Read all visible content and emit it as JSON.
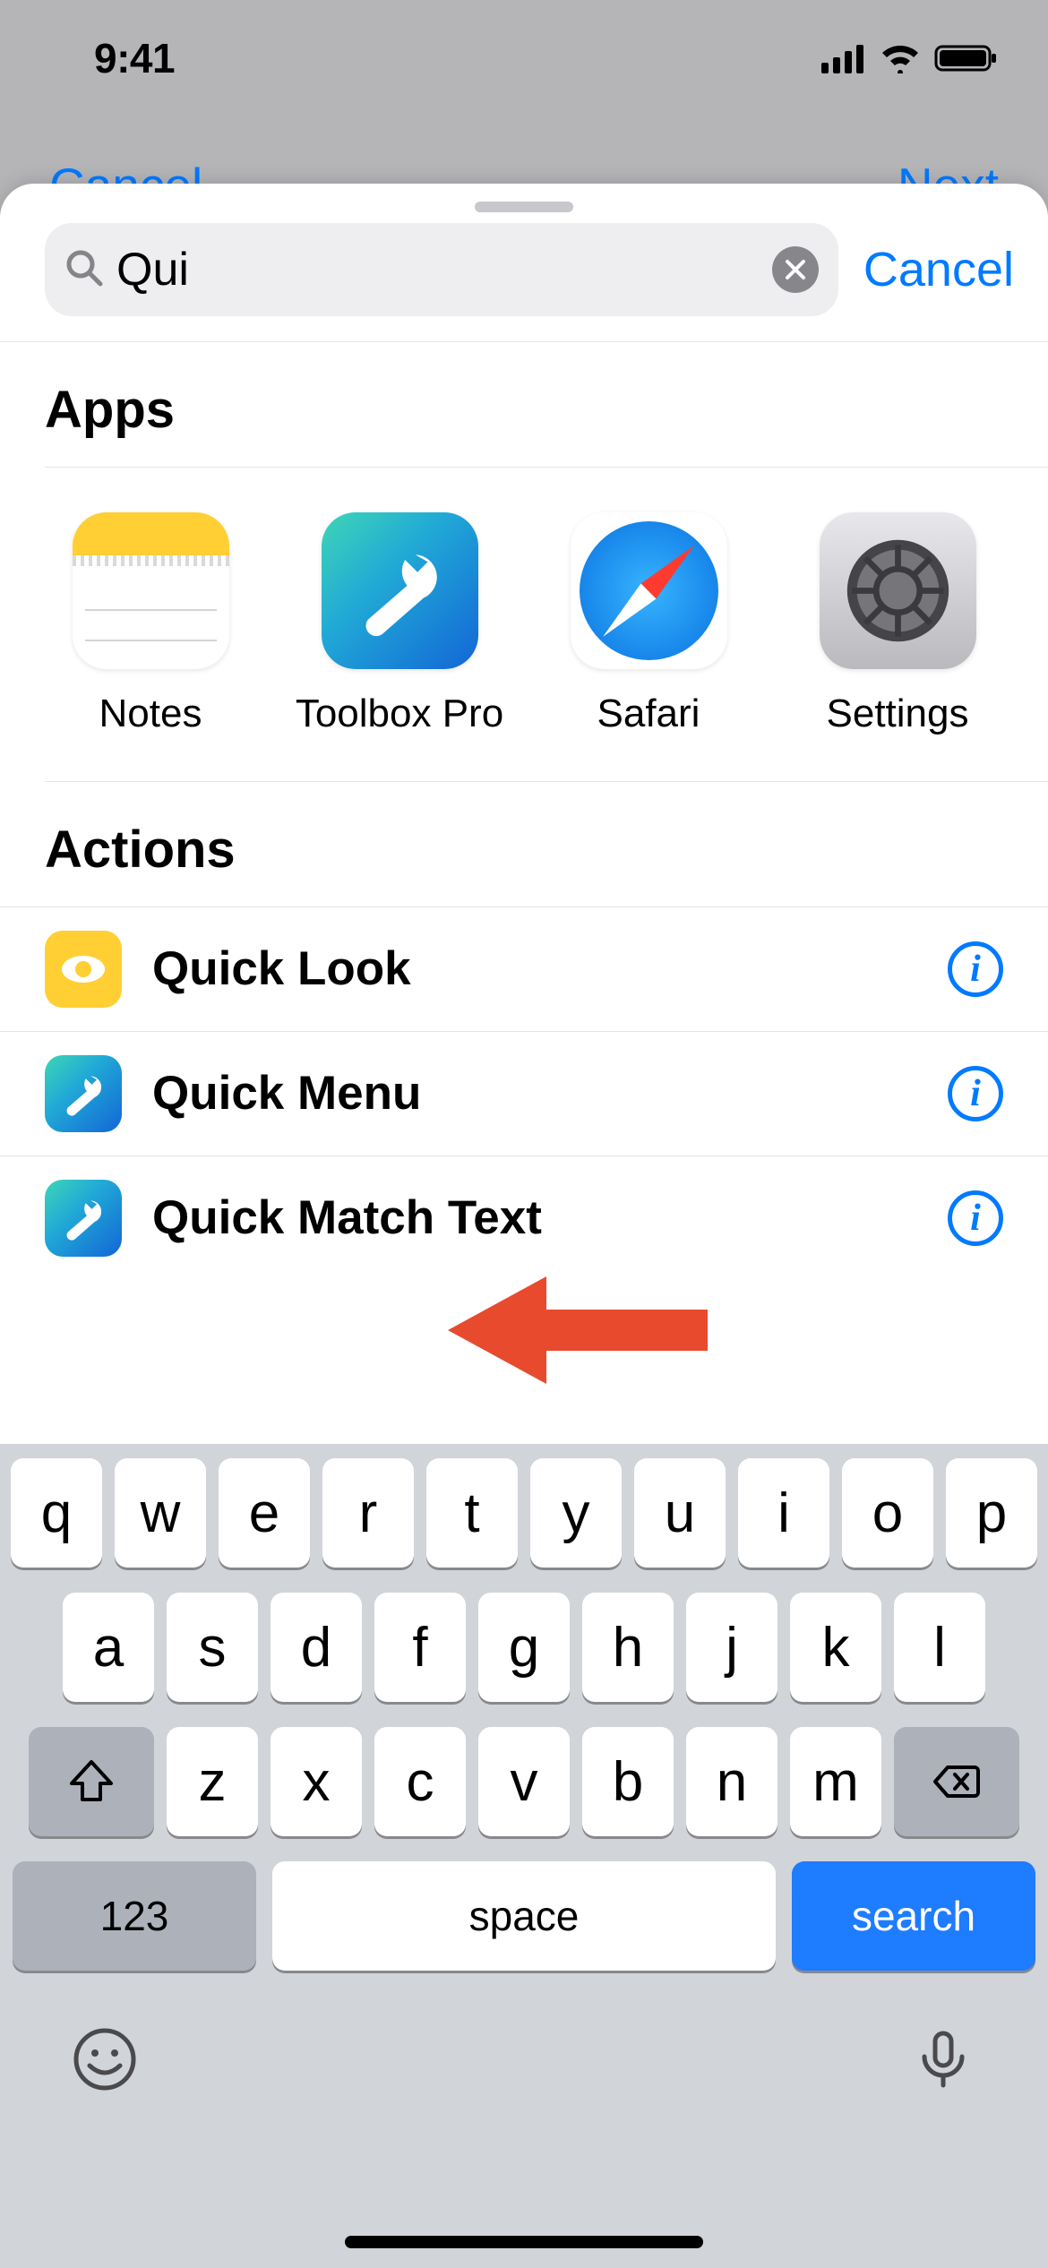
{
  "status_bar": {
    "time": "9:41"
  },
  "nav_behind": {
    "left": "Cancel",
    "right": "Next"
  },
  "search": {
    "value": "Qui",
    "cancel": "Cancel"
  },
  "sections": {
    "apps": {
      "header": "Apps",
      "items": [
        {
          "label": "Notes",
          "icon": "notes"
        },
        {
          "label": "Toolbox Pro",
          "icon": "toolbox"
        },
        {
          "label": "Safari",
          "icon": "safari"
        },
        {
          "label": "Settings",
          "icon": "settings"
        }
      ]
    },
    "actions": {
      "header": "Actions",
      "items": [
        {
          "label": "Quick Look",
          "icon": "eye-yellow"
        },
        {
          "label": "Quick Menu",
          "icon": "toolbox-sm"
        },
        {
          "label": "Quick Match Text",
          "icon": "toolbox-sm"
        }
      ]
    }
  },
  "keyboard": {
    "row1": [
      "q",
      "w",
      "e",
      "r",
      "t",
      "y",
      "u",
      "i",
      "o",
      "p"
    ],
    "row2": [
      "a",
      "s",
      "d",
      "f",
      "g",
      "h",
      "j",
      "k",
      "l"
    ],
    "row3": [
      "z",
      "x",
      "c",
      "v",
      "b",
      "n",
      "m"
    ],
    "num": "123",
    "space": "space",
    "search": "search"
  }
}
